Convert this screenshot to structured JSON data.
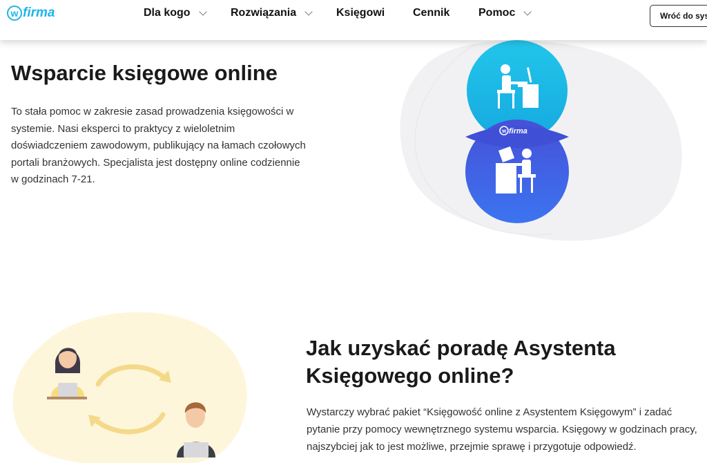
{
  "header": {
    "logo_letter": "w",
    "logo_text": "firma",
    "nav": [
      {
        "label": "Dla kogo",
        "has_dropdown": true
      },
      {
        "label": "Rozwiązania",
        "has_dropdown": true
      },
      {
        "label": "Księgowi",
        "has_dropdown": false
      },
      {
        "label": "Cennik",
        "has_dropdown": false
      },
      {
        "label": "Pomoc",
        "has_dropdown": true
      }
    ],
    "back_button": "Wróć do syst"
  },
  "section1": {
    "title": "Wsparcie księgowe online",
    "body": "To stała pomoc w zakresie zasad prowadzenia księgowości w systemie. Nasi eksperci to praktycy z wieloletnim doświadczeniem zawodowym, publikujący na łamach czołowych portali branżowych. Specjalista jest dostępny online codziennie w godzinach 7-21.",
    "badge_text": "wfirma"
  },
  "section2": {
    "title": "Jak uzyskać poradę Asystenta Księgowego online?",
    "body": "Wystarczy wybrać pakiet “Księgowość online z Asystentem Księgowym” i zadać pytanie przy pomocy wewnętrznego systemu wsparcia. Księgowy w godzinach pracy, najszybciej jak to jest możliwe, przejmie sprawę i przygotuje odpowiedź."
  },
  "colors": {
    "brand": "#1fb4e6",
    "circle_top": "#1ec3ea",
    "circle_bottom": "#3d5fe0",
    "blob_yellow": "#fdf6d9",
    "arrow_yellow": "#f6dc8a"
  }
}
